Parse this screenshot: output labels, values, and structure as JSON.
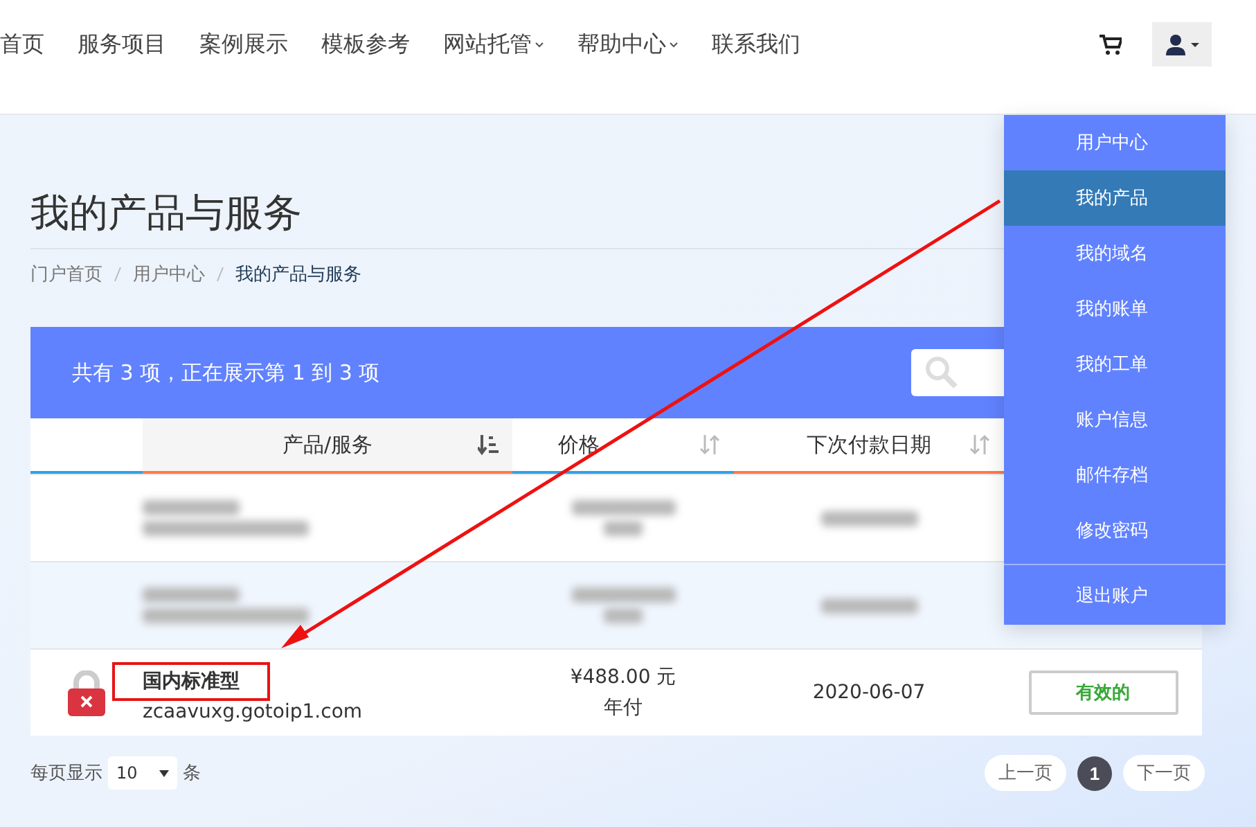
{
  "nav": {
    "items": [
      {
        "label": "首页",
        "caret": false
      },
      {
        "label": "服务项目",
        "caret": false
      },
      {
        "label": "案例展示",
        "caret": false
      },
      {
        "label": "模板参考",
        "caret": false
      },
      {
        "label": "网站托管",
        "caret": true
      },
      {
        "label": "帮助中心",
        "caret": true
      },
      {
        "label": "联系我们",
        "caret": false
      }
    ]
  },
  "page": {
    "title": "我的产品与服务",
    "breadcrumb": [
      {
        "label": "门户首页",
        "current": false
      },
      {
        "label": "用户中心",
        "current": false
      },
      {
        "label": "我的产品与服务",
        "current": true
      }
    ]
  },
  "table": {
    "summary": "共有 3 项，正在展示第 1 到 3 项",
    "columns": [
      {
        "label": "产品/服务",
        "sorted": true
      },
      {
        "label": "价格",
        "sorted": false
      },
      {
        "label": "下次付款日期",
        "sorted": false
      }
    ],
    "rows": [
      {
        "kind": "blurred"
      },
      {
        "kind": "blurred"
      },
      {
        "kind": "product",
        "name": "国内标准型",
        "domain": "zcaavuxg.gotoip1.com",
        "price": "¥488.00 元",
        "cycle": "年付",
        "due": "2020-06-07",
        "status": "有效的",
        "highlighted": true
      }
    ]
  },
  "footer": {
    "per_page_label": "每页显示",
    "per_page": "10",
    "per_page_unit": "条",
    "prev": "上一页",
    "pages": [
      {
        "label": "1",
        "selected": true
      }
    ],
    "next": "下一页"
  },
  "user_menu": {
    "items": [
      {
        "label": "用户中心",
        "selected": false,
        "separated": false
      },
      {
        "label": "我的产品",
        "selected": true,
        "separated": false
      },
      {
        "label": "我的域名",
        "selected": false,
        "separated": false
      },
      {
        "label": "我的账单",
        "selected": false,
        "separated": false
      },
      {
        "label": "我的工单",
        "selected": false,
        "separated": false
      },
      {
        "label": "账户信息",
        "selected": false,
        "separated": false
      },
      {
        "label": "邮件存档",
        "selected": false,
        "separated": false
      },
      {
        "label": "修改密码",
        "selected": false,
        "separated": false
      },
      {
        "label": "退出账户",
        "selected": false,
        "separated": true
      }
    ]
  },
  "annotation_arrow": true
}
